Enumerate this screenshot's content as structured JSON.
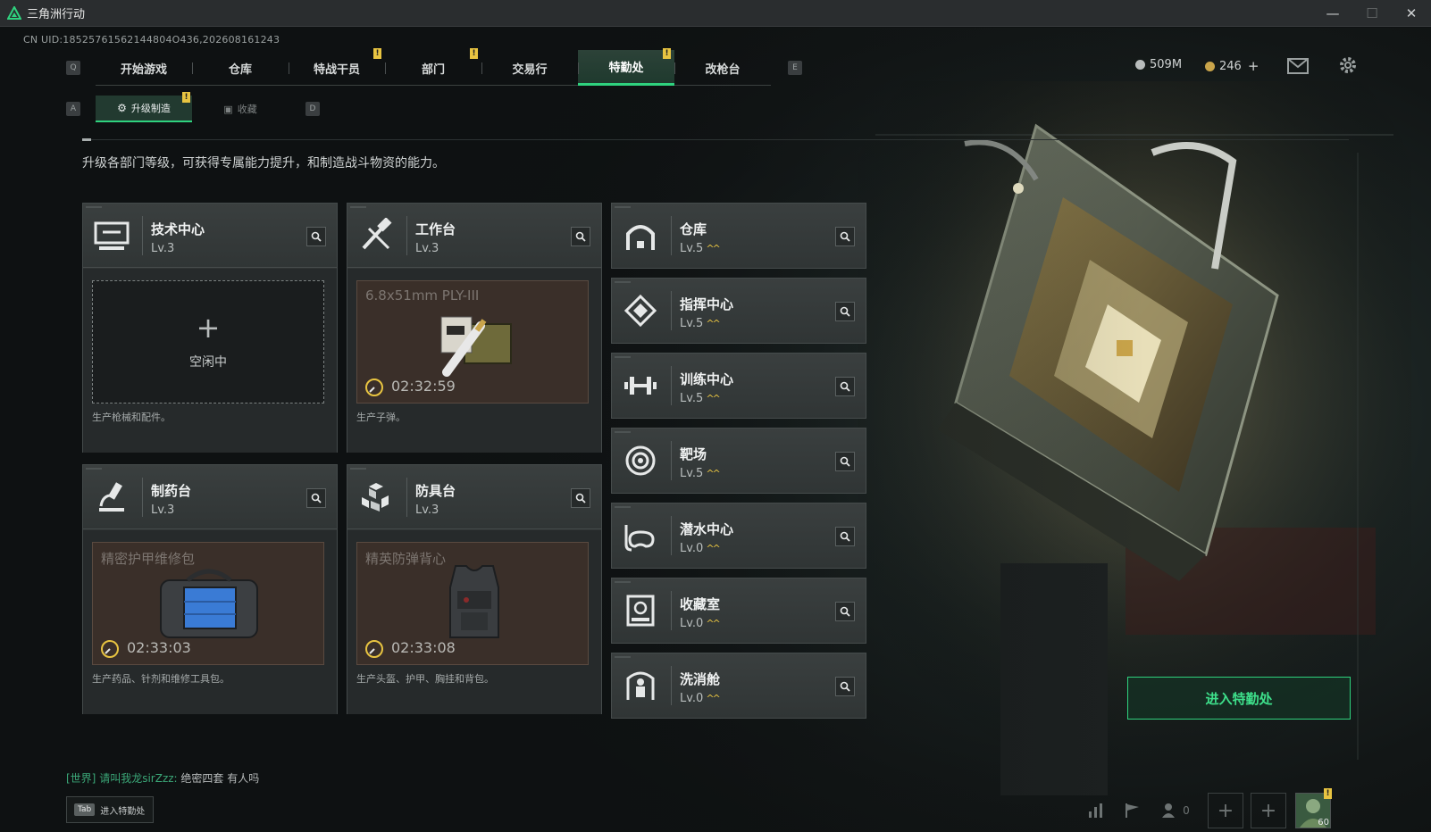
{
  "window": {
    "title": "三角洲行动",
    "minimize": "—",
    "maximize": "☐",
    "close": "✕"
  },
  "uid": "CN UID:18525761562144804O436,202608161243",
  "nav": {
    "key_left": "Q",
    "key_right": "E",
    "tabs": [
      {
        "label": "开始游戏"
      },
      {
        "label": "仓库"
      },
      {
        "label": "特战干员",
        "badge": "!"
      },
      {
        "label": "部门",
        "badge": "!"
      },
      {
        "label": "交易行"
      },
      {
        "label": "特勤处",
        "badge": "!",
        "active": true
      },
      {
        "label": "改枪台"
      }
    ]
  },
  "currency": {
    "silver": "509M",
    "gold": "246",
    "gold_add": "+"
  },
  "subnav": {
    "key_left": "A",
    "key_right": "D",
    "tabs": [
      {
        "label": "升级制造",
        "badge": "!",
        "active": true
      },
      {
        "label": "收藏"
      }
    ]
  },
  "description": "升级各部门等级，可获得专属能力提升，和制造战斗物资的能力。",
  "workstations": [
    {
      "name": "技术中心",
      "level": "Lv.3",
      "status": "idle",
      "idle_label": "空闲中",
      "idle_plus": "+",
      "desc": "生产枪械和配件。",
      "icon": "computer-icon"
    },
    {
      "name": "工作台",
      "level": "Lv.3",
      "status": "busy",
      "item": "6.8x51mm PLY-III",
      "timer": "02:32:59",
      "desc": "生产子弹。",
      "icon": "tools-icon"
    },
    {
      "name": "制药台",
      "level": "Lv.3",
      "status": "busy",
      "item": "精密护甲维修包",
      "timer": "02:33:03",
      "desc": "生产药品、针剂和维修工具包。",
      "icon": "microscope-icon"
    },
    {
      "name": "防具台",
      "level": "Lv.3",
      "status": "busy",
      "item": "精英防弹背心",
      "timer": "02:33:08",
      "desc": "生产头盔、护甲、胸挂和背包。",
      "icon": "cubes-icon"
    }
  ],
  "facilities": [
    {
      "name": "仓库",
      "level": "Lv.5",
      "upgrade": "^^",
      "icon": "warehouse-icon"
    },
    {
      "name": "指挥中心",
      "level": "Lv.5",
      "upgrade": "^^",
      "icon": "chip-icon"
    },
    {
      "name": "训练中心",
      "level": "Lv.5",
      "upgrade": "^^",
      "icon": "dumbbell-icon"
    },
    {
      "name": "靶场",
      "level": "Lv.5",
      "upgrade": "^^",
      "icon": "target-icon"
    },
    {
      "name": "潜水中心",
      "level": "Lv.0",
      "upgrade": "^^",
      "icon": "dive-mask-icon"
    },
    {
      "name": "收藏室",
      "level": "Lv.0",
      "upgrade": "^^",
      "icon": "collection-icon"
    },
    {
      "name": "洗消舱",
      "level": "Lv.0",
      "upgrade": "^^",
      "icon": "decon-icon"
    }
  ],
  "enter_button": "进入特勤处",
  "chat": {
    "channel": "[世界]",
    "sender": "请叫我龙sirZzz:",
    "message": "绝密四套 有人吗"
  },
  "tab_hint": {
    "key": "Tab",
    "label": "进入特勤处"
  },
  "bottom": {
    "squad_count": "0",
    "avatar_level": "60",
    "avatar_badge": "!"
  },
  "colors": {
    "accent": "#2fd27e",
    "badge": "#e8c441",
    "panel": "#2f3333",
    "busy_slot": "#3a2f29"
  }
}
